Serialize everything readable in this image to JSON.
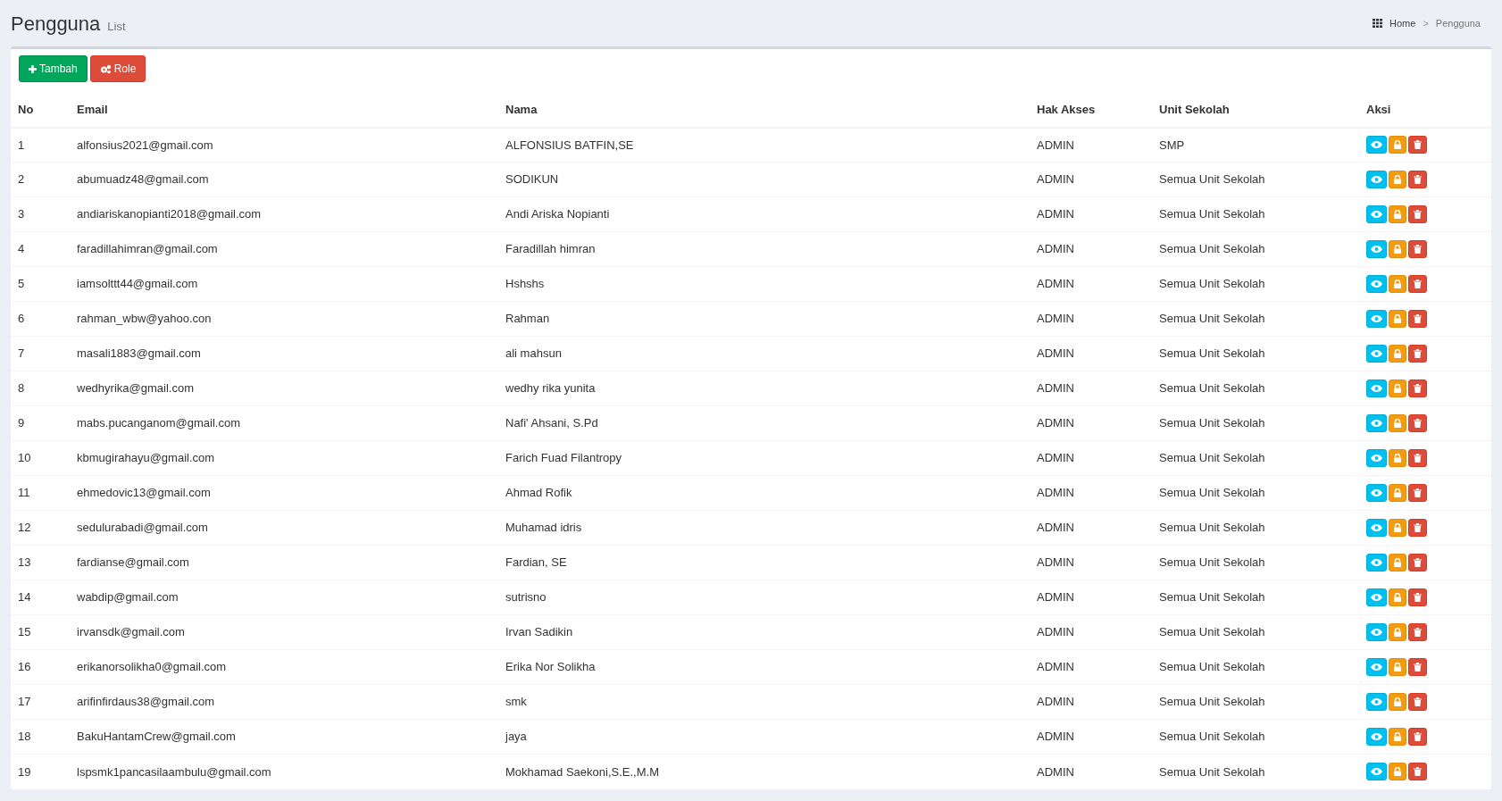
{
  "page_header": {
    "title": "Pengguna",
    "subtitle": "List"
  },
  "breadcrumb": [
    {
      "label": "Home"
    },
    {
      "label": "Pengguna"
    }
  ],
  "breadcrumb_separator": ">",
  "toolbar": [
    {
      "kind": "add",
      "label": "Tambah"
    },
    {
      "kind": "role",
      "label": "Role"
    }
  ],
  "table": {
    "columns": [
      "No",
      "Email",
      "Nama",
      "Hak Akses",
      "Unit Sekolah",
      "Aksi"
    ],
    "row_actions": [
      {
        "kind": "view"
      },
      {
        "kind": "lock"
      },
      {
        "kind": "delete"
      }
    ],
    "rows": [
      [
        "1",
        "alfonsius2021@gmail.com",
        "ALFONSIUS BATFIN,SE",
        "ADMIN",
        "SMP"
      ],
      [
        "2",
        "abumuadz48@gmail.com",
        "SODIKUN",
        "ADMIN",
        "Semua Unit Sekolah"
      ],
      [
        "3",
        "andiariskanopianti2018@gmail.com",
        "Andi Ariska Nopianti",
        "ADMIN",
        "Semua Unit Sekolah"
      ],
      [
        "4",
        "faradillahimran@gmail.com",
        "Faradillah himran",
        "ADMIN",
        "Semua Unit Sekolah"
      ],
      [
        "5",
        "iamsolttt44@gmail.com",
        "Hshshs",
        "ADMIN",
        "Semua Unit Sekolah"
      ],
      [
        "6",
        "rahman_wbw@yahoo.con",
        "Rahman",
        "ADMIN",
        "Semua Unit Sekolah"
      ],
      [
        "7",
        "masali1883@gmail.com",
        "ali mahsun",
        "ADMIN",
        "Semua Unit Sekolah"
      ],
      [
        "8",
        "wedhyrika@gmail.com",
        "wedhy rika yunita",
        "ADMIN",
        "Semua Unit Sekolah"
      ],
      [
        "9",
        "mabs.pucanganom@gmail.com",
        "Nafi' Ahsani, S.Pd",
        "ADMIN",
        "Semua Unit Sekolah"
      ],
      [
        "10",
        "kbmugirahayu@gmail.com",
        "Farich Fuad Filantropy",
        "ADMIN",
        "Semua Unit Sekolah"
      ],
      [
        "11",
        "ehmedovic13@gmail.com",
        "Ahmad Rofik",
        "ADMIN",
        "Semua Unit Sekolah"
      ],
      [
        "12",
        "sedulurabadi@gmail.com",
        "Muhamad idris",
        "ADMIN",
        "Semua Unit Sekolah"
      ],
      [
        "13",
        "fardianse@gmail.com",
        "Fardian, SE",
        "ADMIN",
        "Semua Unit Sekolah"
      ],
      [
        "14",
        "wabdip@gmail.com",
        "sutrisno",
        "ADMIN",
        "Semua Unit Sekolah"
      ],
      [
        "15",
        "irvansdk@gmail.com",
        "Irvan Sadikin",
        "ADMIN",
        "Semua Unit Sekolah"
      ],
      [
        "16",
        "erikanorsolikha0@gmail.com",
        "Erika Nor Solikha",
        "ADMIN",
        "Semua Unit Sekolah"
      ],
      [
        "17",
        "arifinfirdaus38@gmail.com",
        "smk",
        "ADMIN",
        "Semua Unit Sekolah"
      ],
      [
        "18",
        "BakuHantamCrew@gmail.com",
        "jaya",
        "ADMIN",
        "Semua Unit Sekolah"
      ],
      [
        "19",
        "lspsmk1pancasilaambulu@gmail.com",
        "Mokhamad Saekoni,S.E.,M.M",
        "ADMIN",
        "Semua Unit Sekolah"
      ]
    ]
  }
}
